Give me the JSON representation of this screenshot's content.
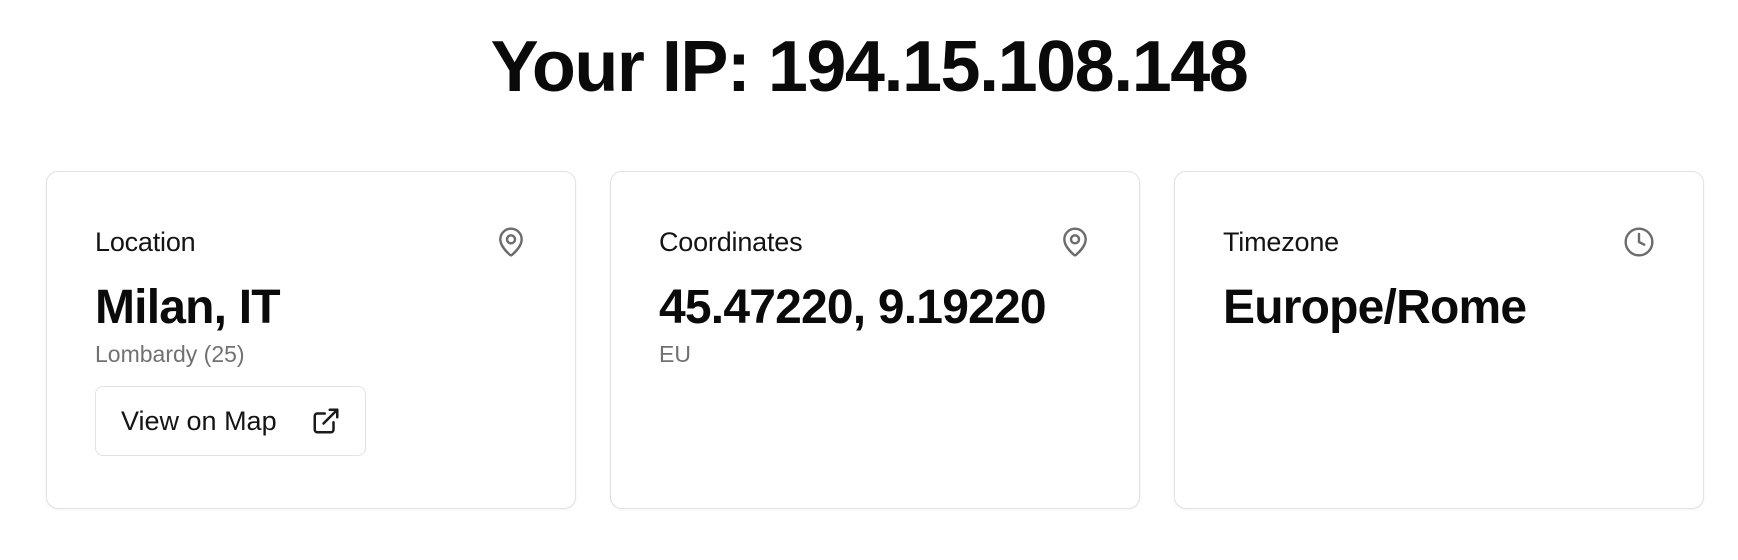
{
  "header": {
    "title": "Your IP: 194.15.108.148"
  },
  "cards": {
    "location": {
      "label": "Location",
      "icon": "map-pin-icon",
      "value": "Milan, IT",
      "sub": "Lombardy (25)",
      "button_label": "View on Map",
      "button_icon": "external-link-icon"
    },
    "coordinates": {
      "label": "Coordinates",
      "icon": "map-pin-icon",
      "value": "45.47220, 9.19220",
      "sub": "EU"
    },
    "timezone": {
      "label": "Timezone",
      "icon": "clock-icon",
      "value": "Europe/Rome"
    }
  },
  "colors": {
    "text": "#0a0a0a",
    "muted": "#717175",
    "icon": "#6b6b70",
    "border": "#e2e2e4"
  }
}
